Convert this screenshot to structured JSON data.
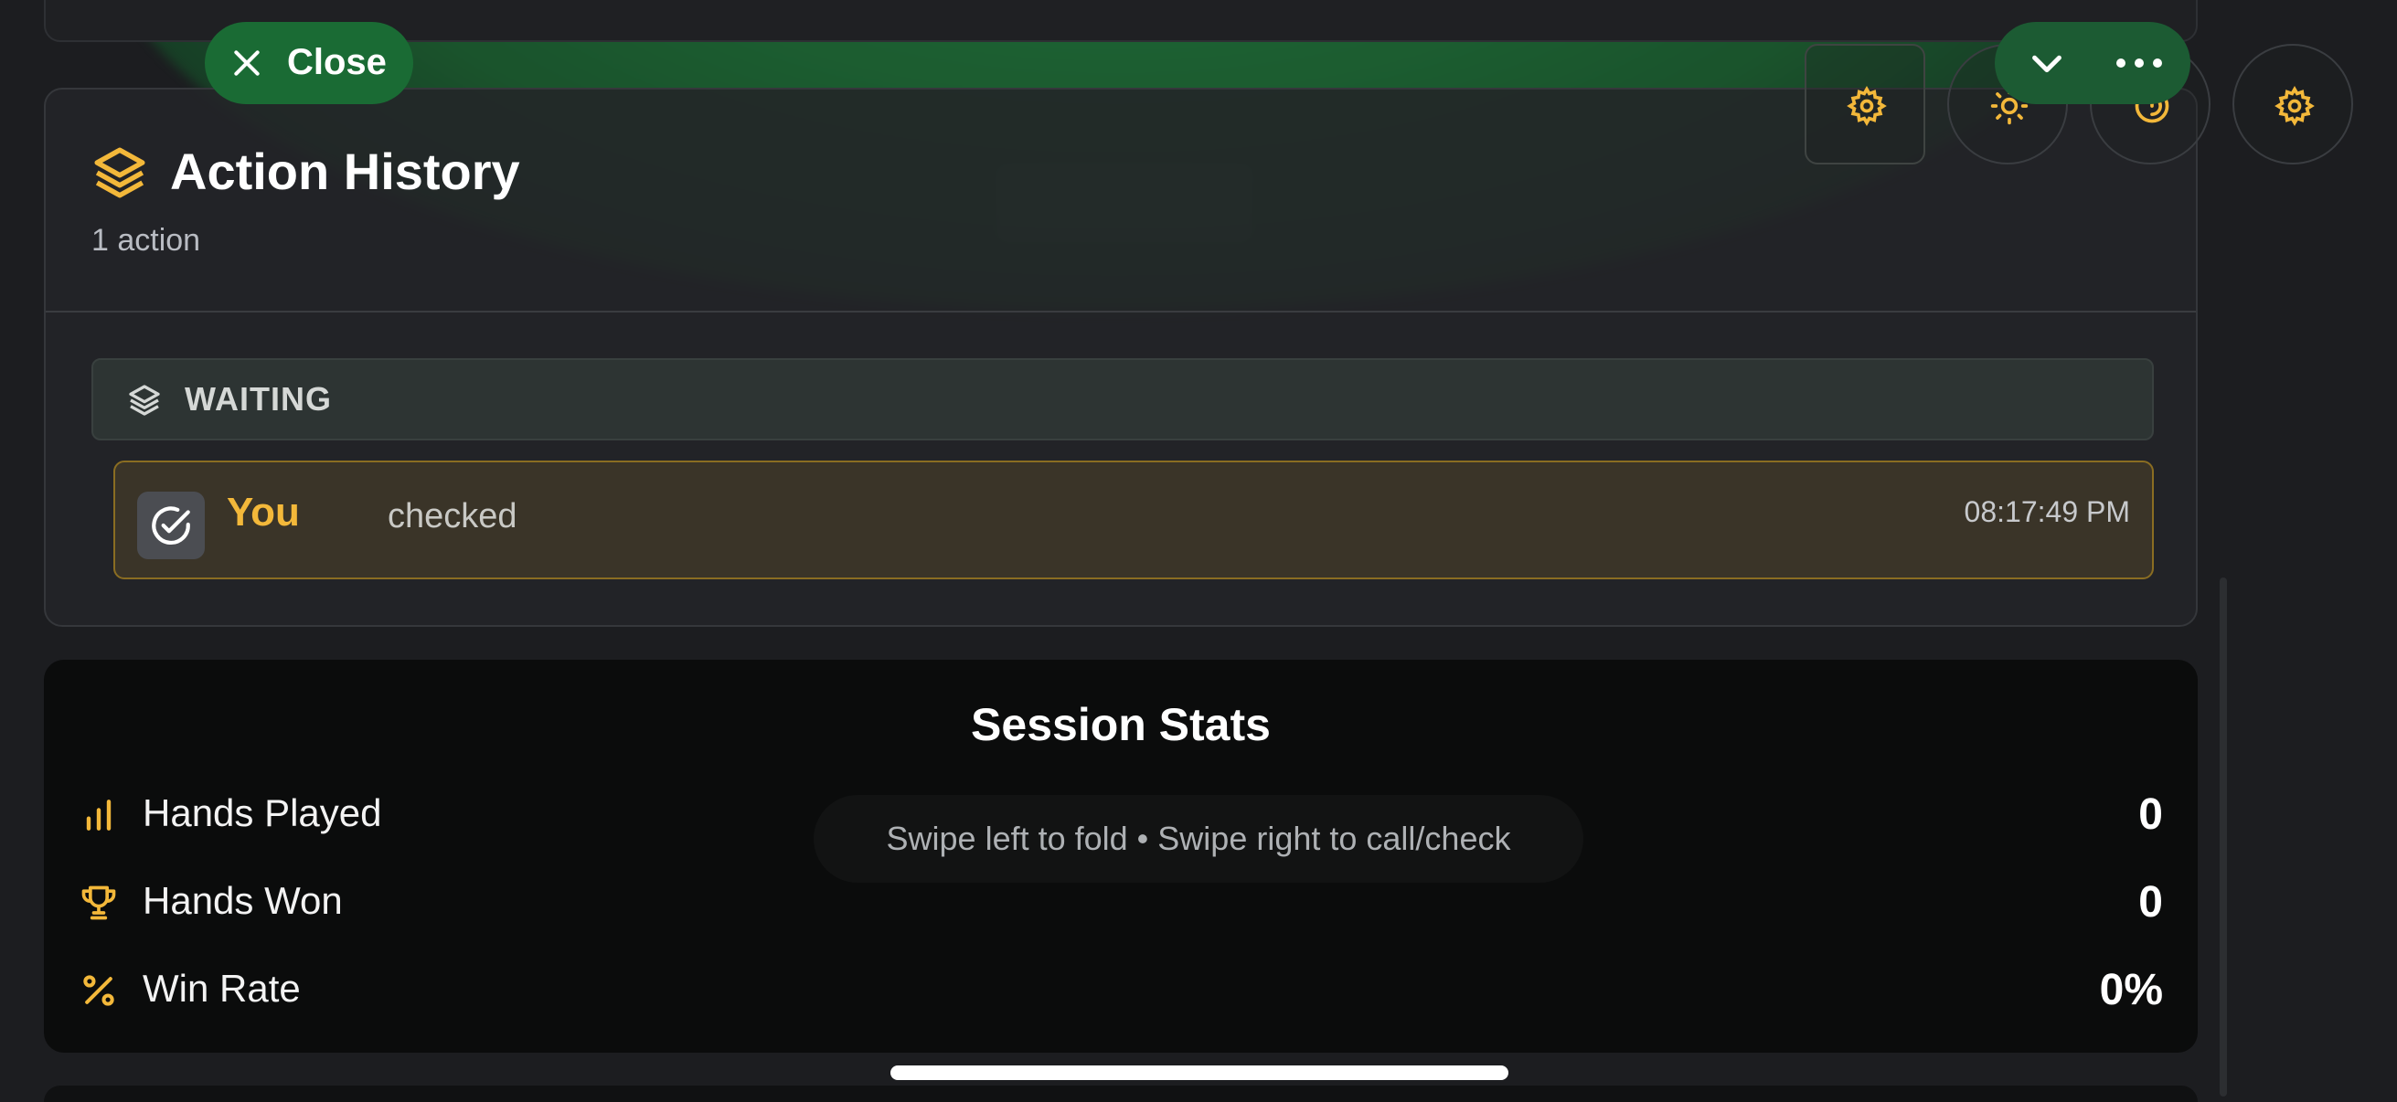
{
  "close_button": {
    "label": "Close"
  },
  "action_history": {
    "title": "Action History",
    "count": "1 action",
    "phase": "WAITING",
    "entries": [
      {
        "actor": "You",
        "verb": "checked",
        "time": "08:17:49 PM"
      }
    ]
  },
  "session_stats": {
    "title": "Session Stats",
    "rows": [
      {
        "label": "Hands Played",
        "value": "0",
        "icon": "bar-chart-icon"
      },
      {
        "label": "Hands Won",
        "value": "0",
        "icon": "trophy-icon"
      },
      {
        "label": "Win Rate",
        "value": "0%",
        "icon": "percent-icon"
      }
    ]
  },
  "swipe_hint": "Swipe left to fold • Swipe right to call/check",
  "colors": {
    "accent": "#f3b83a",
    "table_green": "#1a6b34",
    "panel": "#232428",
    "stats_panel": "#0b0c0c"
  },
  "icons": {
    "top_controls": [
      "settings-icon",
      "brightness-icon",
      "timer-icon",
      "settings-icon"
    ],
    "top_pill": [
      "chevron-down-icon",
      "more-icon"
    ]
  }
}
